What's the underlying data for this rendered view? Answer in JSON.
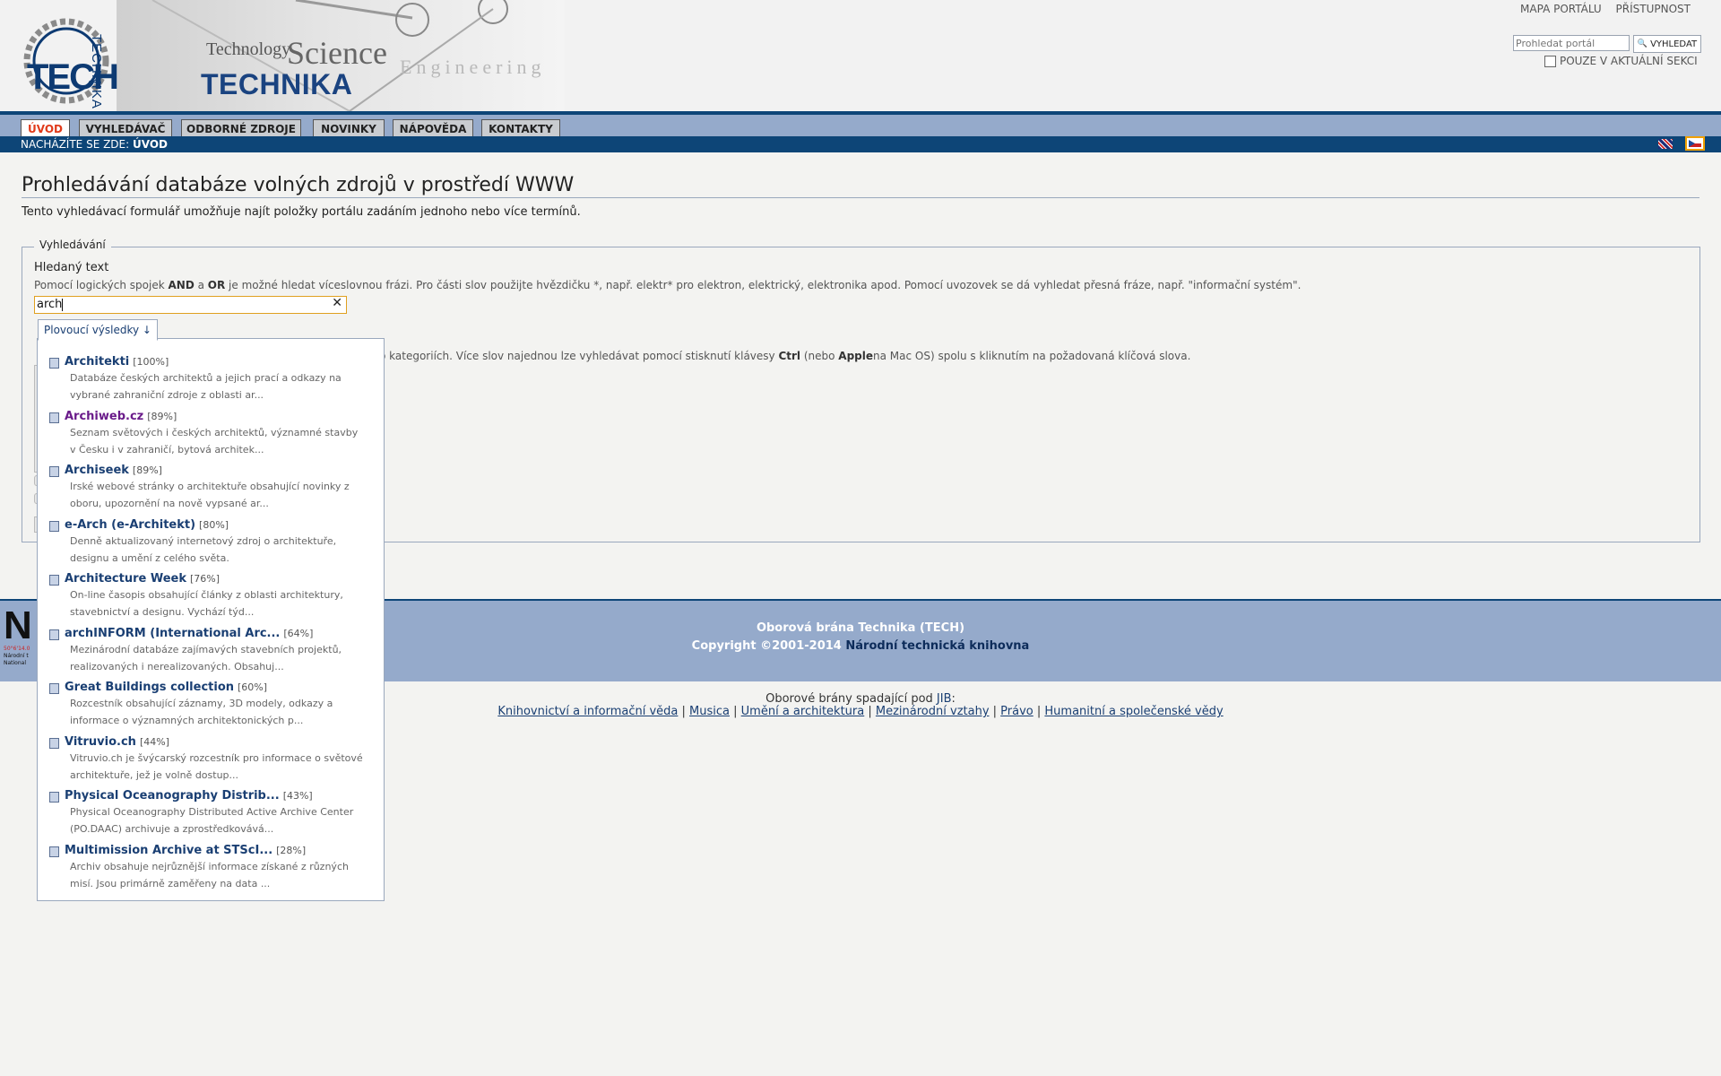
{
  "header": {
    "logo_tech": "TECH",
    "logo_vertical": "TECHNIKA",
    "tagline_technology": "Technology",
    "tagline_science": "Science",
    "tagline_technika": "TECHNIKA",
    "tagline_engineering": "Engineering",
    "top_links": [
      "MAPA PORTÁLU",
      "PŘÍSTUPNOST"
    ],
    "search_placeholder": "Prohledat portál",
    "search_button": "VYHLEDAT",
    "section_only_label": "POUZE V AKTUÁLNÍ SEKCI"
  },
  "nav": {
    "tabs": [
      "ÚVOD",
      "VYHLEDÁVAČ",
      "ODBORNÉ ZDROJE",
      "NOVINKY",
      "NÁPOVĚDA",
      "KONTAKTY"
    ],
    "active_tab": "ÚVOD"
  },
  "breadcrumb": {
    "prefix": "NACHÁZÍTE SE ZDE:",
    "current": "ÚVOD"
  },
  "main": {
    "title": "Prohledávání databáze volných zdrojů v prostředí WWW",
    "intro": "Tento vyhledávací formulář umožňuje najít položky portálu zadáním jednoho nebo více termínů.",
    "legend": "Vyhledávání",
    "field_label": "Hledaný text",
    "help_parts": [
      "Pomocí logických spojek ",
      "AND",
      " a ",
      "OR",
      " je možné hledat víceslovnou frázi. Pro části slov použijte hvězdičku *, např. elektr* pro elektron, elektrický, elektronika apod. Pomocí uvozovek se dá vyhledat přesná fráze, např. \"informační systém\"."
    ],
    "query_value": "arch",
    "second_help_parts": [
      "o kategoriích. Více slov najednou lze vyhledávat pomocí stisknutí klávesy ",
      "Ctrl",
      " (nebo ",
      "Apple",
      "na Mac OS) spolu s kliknutím na požadovaná klíčová slova."
    ]
  },
  "live_search": {
    "tab_label": "Plovoucí výsledky ↓",
    "results": [
      {
        "title": "Architekti",
        "pct": "[100%]",
        "desc": "Databáze českých architektů a jejich prací a odkazy na vybrané zahraniční zdroje z oblasti ar..."
      },
      {
        "title": "Archiweb.cz",
        "pct": "[89%]",
        "desc": "Seznam světových i českých architektů, významné stavby v Česku i v zahraničí, bytová architek...",
        "visited": true
      },
      {
        "title": "Archiseek",
        "pct": "[89%]",
        "desc": "Irské webové stránky o architektuře obsahující novinky z oboru, upozornění na nově vypsané ar..."
      },
      {
        "title": "e-Arch (e-Architekt)",
        "pct": "[80%]",
        "desc": "Denně aktualizovaný internetový zdroj o architektuře, designu a umění z celého světa."
      },
      {
        "title": "Architecture Week",
        "pct": "[76%]",
        "desc": "On-line časopis obsahující články z oblasti architektury, stavebnictví a designu. Vychází týd..."
      },
      {
        "title": "archINFORM (International Arc...",
        "pct": "[64%]",
        "desc": "Mezinárodní databáze zajímavých stavebních projektů, realizovaných i nerealizovaných. Obsahuj..."
      },
      {
        "title": "Great Buildings collection",
        "pct": "[60%]",
        "desc": "Rozcestník obsahující záznamy, 3D modely, odkazy a informace o významných architektonických p..."
      },
      {
        "title": "Vitruvio.ch",
        "pct": "[44%]",
        "desc": "Vitruvio.ch je švýcarský rozcestník pro informace o světové architektuře, jež je volně dostup..."
      },
      {
        "title": "Physical Oceanography Distrib...",
        "pct": "[43%]",
        "desc": "Physical Oceanography Distributed Active Archive Center (PO.DAAC) archivuje a zprostředkovává..."
      },
      {
        "title": "Multimission Archive at STScI...",
        "pct": "[28%]",
        "desc": "Archiv obsahuje nejrůznější informace získané z různých misí. Jsou primárně zaměřeny na data ..."
      }
    ]
  },
  "footer": {
    "ntk_logo": "N",
    "ntk_small": [
      "50°6'14.0",
      "Národní t",
      "National"
    ],
    "line1": "Oborová brána Technika (TECH)",
    "line2_prefix": "Copyright ©2001-2014 ",
    "line2_link": "Národní technická knihovna",
    "gateways_prefix": "Oborové brány spadající pod ",
    "gateways_jib": "JIB",
    "gateways_suffix": ":",
    "gateway_links": [
      "Knihovnictví a informační věda",
      "Musica",
      "Umění a architektura",
      "Mezinárodní vztahy",
      "Právo",
      "Humanitní a společenské vědy"
    ]
  },
  "colors": {
    "brand_blue": "#0d4577",
    "nav_band": "#95aacb",
    "active_tab_text": "#e03a1a",
    "focus_border": "#e0a020"
  }
}
